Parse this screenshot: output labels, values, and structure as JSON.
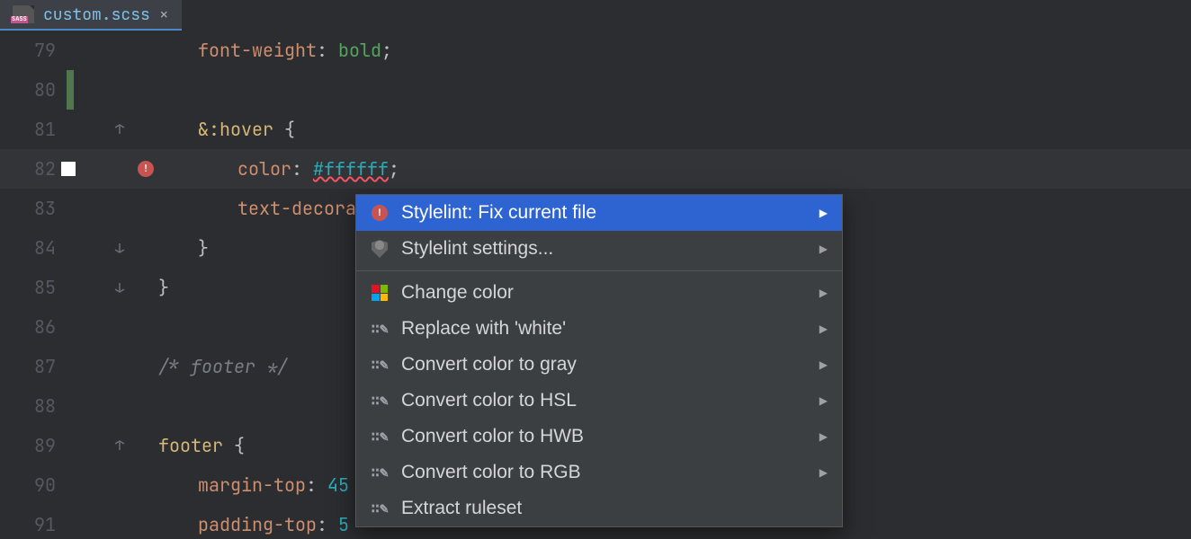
{
  "tab": {
    "filename": "custom.scss"
  },
  "lines": [
    {
      "num": "79",
      "indent": 1,
      "tokens": [
        [
          "kw",
          "font-weight"
        ],
        [
          "cs",
          ": "
        ],
        [
          "val",
          "bold"
        ],
        [
          "cs",
          ";"
        ]
      ]
    },
    {
      "num": "80",
      "indent": 1,
      "tokens": [],
      "diffbar": true
    },
    {
      "num": "81",
      "indent": 1,
      "fold": "open",
      "tokens": [
        [
          "sel",
          "&"
        ],
        [
          "pseudo",
          ":hover"
        ],
        [
          "cs",
          " "
        ],
        [
          "brace",
          "{"
        ]
      ]
    },
    {
      "num": "82",
      "indent": 2,
      "highlight": true,
      "swatch": true,
      "bulb": true,
      "tokens": [
        [
          "kw",
          "color"
        ],
        [
          "cs",
          ": "
        ],
        [
          "colorlit",
          "#ffffff"
        ],
        [
          "cs",
          ";"
        ]
      ]
    },
    {
      "num": "83",
      "indent": 2,
      "tokens": [
        [
          "kw",
          "text-decorat"
        ]
      ]
    },
    {
      "num": "84",
      "indent": 1,
      "fold": "close",
      "tokens": [
        [
          "brace",
          "}"
        ]
      ]
    },
    {
      "num": "85",
      "indent": 0,
      "fold": "close",
      "tokens": [
        [
          "brace",
          "}"
        ]
      ]
    },
    {
      "num": "86",
      "indent": 0,
      "tokens": []
    },
    {
      "num": "87",
      "indent": 0,
      "tokens": [
        [
          "comment",
          "/* footer */"
        ]
      ]
    },
    {
      "num": "88",
      "indent": 0,
      "tokens": []
    },
    {
      "num": "89",
      "indent": 0,
      "fold": "open",
      "tokens": [
        [
          "sel",
          "footer"
        ],
        [
          "cs",
          " "
        ],
        [
          "brace",
          "{"
        ]
      ]
    },
    {
      "num": "90",
      "indent": 1,
      "tokens": [
        [
          "kw",
          "margin-top"
        ],
        [
          "cs",
          ": "
        ],
        [
          "num",
          "45"
        ]
      ]
    },
    {
      "num": "91",
      "indent": 1,
      "tokens": [
        [
          "kw",
          "padding-top"
        ],
        [
          "cs",
          ": "
        ],
        [
          "num",
          "5"
        ]
      ]
    }
  ],
  "menu": {
    "items": [
      {
        "icon": "bulb",
        "label": "Stylelint: Fix current file",
        "arrow": true,
        "selected": true
      },
      {
        "icon": "shield",
        "label": "Stylelint settings...",
        "arrow": true
      },
      {
        "sep": true
      },
      {
        "icon": "colors",
        "label": "Change color",
        "arrow": true
      },
      {
        "icon": "ia",
        "label": "Replace with 'white'",
        "arrow": true
      },
      {
        "icon": "ia",
        "label": "Convert color to gray",
        "arrow": true
      },
      {
        "icon": "ia",
        "label": "Convert color to HSL",
        "arrow": true
      },
      {
        "icon": "ia",
        "label": "Convert color to HWB",
        "arrow": true
      },
      {
        "icon": "ia",
        "label": "Convert color to RGB",
        "arrow": true
      },
      {
        "icon": "ia",
        "label": "Extract ruleset"
      }
    ]
  }
}
